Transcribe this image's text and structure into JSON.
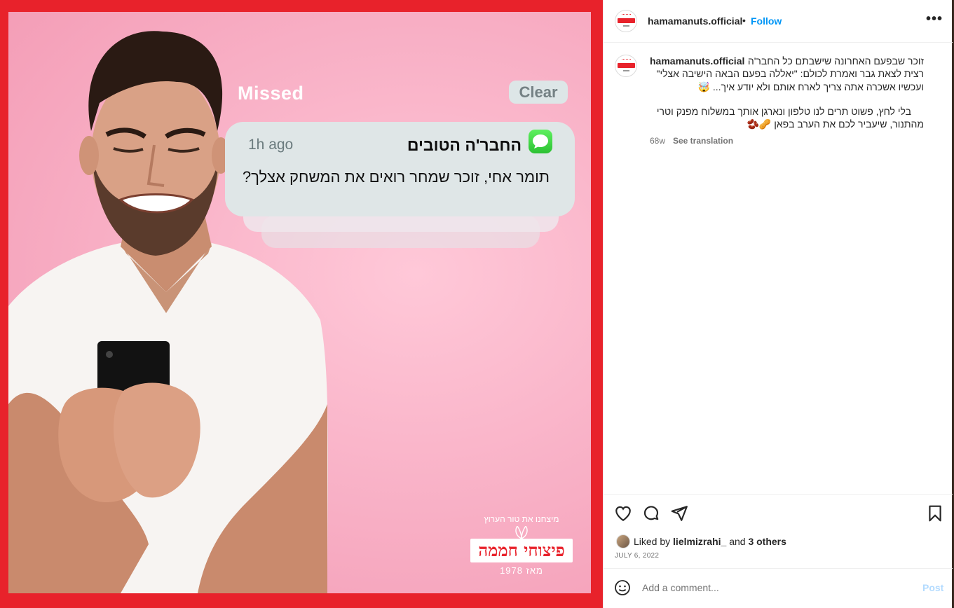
{
  "post_image": {
    "notification": {
      "section_label": "Missed",
      "clear_label": "Clear",
      "time": "1h ago",
      "app_name": "החבר'ה הטובים",
      "app_icon": "messages-icon",
      "message": "תומר אחי, זוכר שמחר רואים את המשחק אצלך?"
    },
    "logo": {
      "tagline": "מיצחנו את טור הערוץ",
      "brand": "פיצוחי חממה",
      "since": "מאז 1978"
    },
    "colors": {
      "frame": "#e8222b",
      "background": "#f7b0c6"
    }
  },
  "header": {
    "username": "hamamanuts.official",
    "separator": "•",
    "follow_label": "Follow",
    "more_label": "•••"
  },
  "caption": {
    "username": "hamamanuts.official",
    "line1": "זוכר שבפעם האחרונה שישבתם כל החבר'ה",
    "line2": "רצית לצאת גבר ואמרת לכולם: \"יאללה בפעם הבאה הישיבה אצלי\"",
    "line3": "ועכשיו אשכרה אתה צריך לארח אותם ולא יודע איך... 🤯",
    "line4": "בלי לחץ, פשוט תרים לנו טלפון ונארגן אותך במשלוח מפנק וטרי",
    "line5": "מהתנור, שיעביר לכם את הערב בפאן 🥜🫘",
    "age": "68w",
    "translate_label": "See translation"
  },
  "actions": {
    "likes_prefix": "Liked by",
    "liker": "lielmizrahi_",
    "likes_and": "and",
    "others": "3 others",
    "date": "JULY 6, 2022"
  },
  "comment": {
    "placeholder": "Add a comment...",
    "post_label": "Post"
  }
}
